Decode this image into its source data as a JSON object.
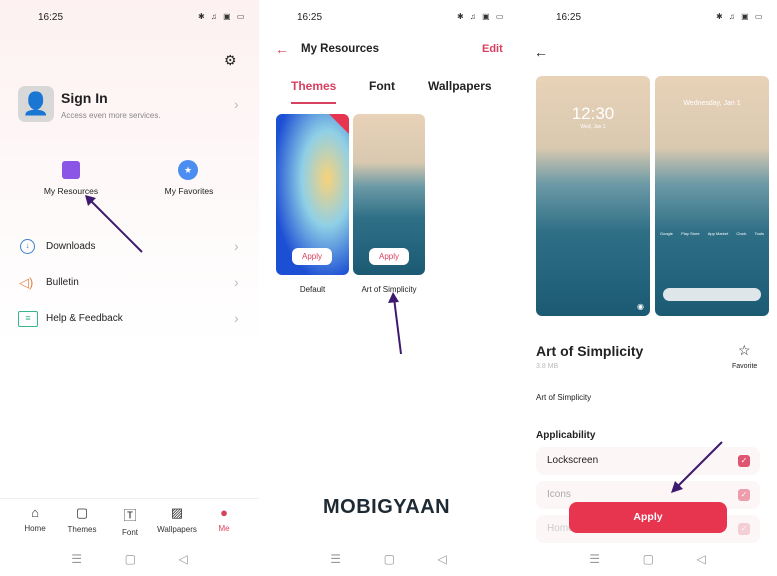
{
  "status": {
    "time": "16:25",
    "icons": "bluetooth mute nfc battery"
  },
  "screen1": {
    "sign_in": {
      "title": "Sign In",
      "subtitle": "Access even more services."
    },
    "shortcuts": [
      {
        "label": "My Resources",
        "icon": "bag-icon"
      },
      {
        "label": "My Favorites",
        "icon": "star-icon"
      }
    ],
    "menu": [
      {
        "label": "Downloads",
        "icon": "download-icon"
      },
      {
        "label": "Bulletin",
        "icon": "speaker-icon"
      },
      {
        "label": "Help & Feedback",
        "icon": "chat-icon"
      }
    ],
    "tabs": [
      {
        "label": "Home"
      },
      {
        "label": "Themes"
      },
      {
        "label": "Font"
      },
      {
        "label": "Wallpapers"
      },
      {
        "label": "Me",
        "active": true
      }
    ]
  },
  "screen2": {
    "title": "My Resources",
    "edit": "Edit",
    "tabs": [
      "Themes",
      "Font",
      "Wallpapers"
    ],
    "themes": [
      {
        "name": "Default",
        "apply": "Apply",
        "selected": true
      },
      {
        "name": "Art of Simplicity",
        "apply": "Apply"
      }
    ],
    "watermark": "MOBIGYAAN"
  },
  "screen3": {
    "lock_time": "12:30",
    "lock_date": "Wed, Jan 1",
    "home_date": "Wednesday, Jan 1",
    "apps": [
      "Google",
      "Play Store",
      "App Market",
      "Clock",
      "Tools"
    ],
    "title": "Art of Simplicity",
    "size": "3.8 MB",
    "favorite": "Favorite",
    "description": "Art of Simplicity",
    "applicability_title": "Applicability",
    "applicability": [
      {
        "label": "Lockscreen",
        "checked": true
      },
      {
        "label": "Icons",
        "checked": true
      },
      {
        "label": "Home",
        "checked": true
      }
    ],
    "apply": "Apply"
  },
  "colors": {
    "accent": "#e8354f",
    "arrow": "#3d1a6e"
  }
}
